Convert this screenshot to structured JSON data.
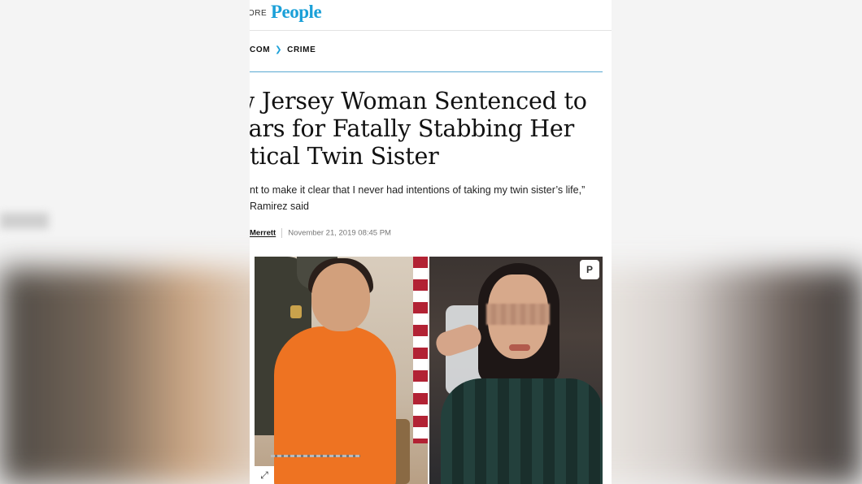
{
  "topbar": {
    "more_label": "ORE",
    "logo": "People"
  },
  "breadcrumb": {
    "home": "COM",
    "separator": "❯",
    "section": "CRIME"
  },
  "article": {
    "headline": "w Jersey Woman Sentenced to ears for Fatally Stabbing Her ntical Twin Sister",
    "deck": "nt to make it clear that I never had intentions of taking my twin sister’s life,”  Ramirez said",
    "author": "Merrett",
    "timestamp": "November 21, 2019 08:45 PM"
  },
  "photo": {
    "pin_icon": "P",
    "expand_icon": "⤢"
  },
  "colors": {
    "brand": "#1ba0d8",
    "rule": "#5aa9d1",
    "jumpsuit": "#ee7322"
  }
}
